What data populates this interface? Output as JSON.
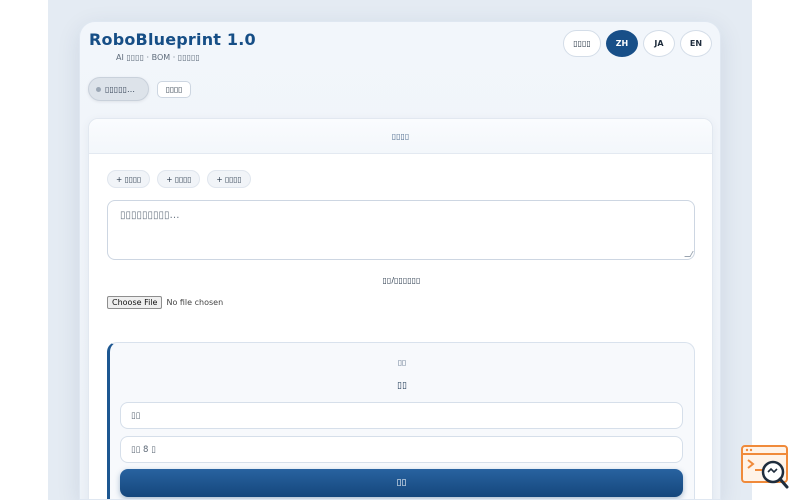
{
  "app": {
    "title": "RoboBlueprint 1.0",
    "subtitle": "AI ▯▯▯▯ · BOM · ▯▯▯▯▯"
  },
  "header": {
    "settings_label": "▯▯▯▯",
    "languages": [
      {
        "code": "ZH",
        "active": true
      },
      {
        "code": "JA",
        "active": false
      },
      {
        "code": "EN",
        "active": false
      }
    ]
  },
  "status": {
    "chip_label": "▯▯▯▯▯…",
    "side_button": "▯▯▯▯"
  },
  "card": {
    "header_label": "▯▯▯▯",
    "tags": [
      "+ ▯▯▯▯",
      "+ ▯▯▯▯",
      "+ ▯▯▯▯"
    ],
    "prompt_placeholder": "▯▯▯▯▯▯▯▯▯…",
    "upload_label": "▯▯/▯▯▯▯▯▯",
    "file_button": "Choose File",
    "file_status": "No file chosen"
  },
  "auth": {
    "caption": "▯▯",
    "title": "▯▯",
    "username_placeholder": "▯▯",
    "password_placeholder": "▯▯ 8 ▯",
    "submit_label": "▯▯",
    "link_text": "▯▯▯▯▯▯"
  },
  "colors": {
    "brand": "#164e86",
    "primary_button": "#15477c",
    "accent_orange": "#f08a3a"
  }
}
